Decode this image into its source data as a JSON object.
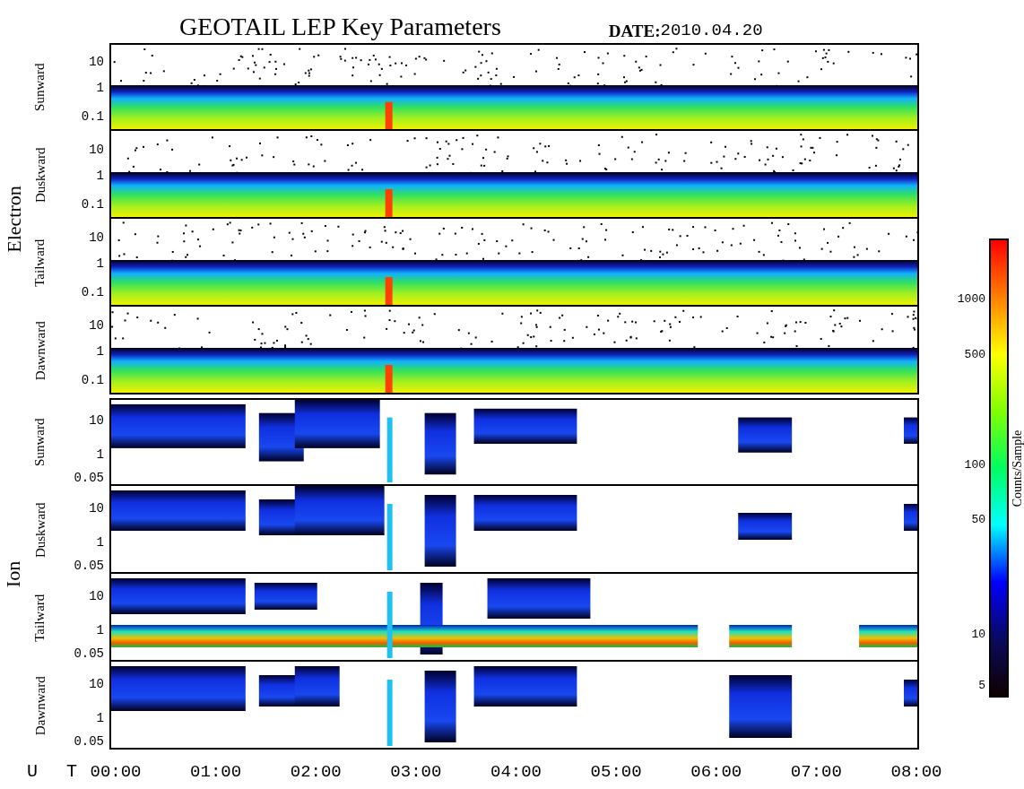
{
  "title": "GEOTAIL LEP Key Parameters",
  "date": {
    "label": "DATE:",
    "value": "2010.04.20"
  },
  "groups": [
    {
      "label": "Electron",
      "kind": "electron",
      "panels": [
        {
          "label": "Sunward",
          "yticks": [
            "10",
            "1",
            "0.1"
          ]
        },
        {
          "label": "Duskward",
          "yticks": [
            "10",
            "1",
            "0.1"
          ]
        },
        {
          "label": "Tailward",
          "yticks": [
            "10",
            "1",
            "0.1"
          ]
        },
        {
          "label": "Dawnward",
          "yticks": [
            "10",
            "1",
            "0.1"
          ]
        }
      ]
    },
    {
      "label": "Ion",
      "kind": "ion",
      "panels": [
        {
          "label": "Sunward",
          "yticks": [
            "10",
            "1",
            "0.05"
          ]
        },
        {
          "label": "Duskward",
          "yticks": [
            "10",
            "1",
            "0.05"
          ]
        },
        {
          "label": "Tailward",
          "yticks": [
            "10",
            "1",
            "0.05"
          ]
        },
        {
          "label": "Dawnward",
          "yticks": [
            "10",
            "1",
            "0.05"
          ]
        }
      ]
    }
  ],
  "x_axis": {
    "label": "U T",
    "ticks": [
      "00:00",
      "01:00",
      "02:00",
      "03:00",
      "04:00",
      "05:00",
      "06:00",
      "07:00",
      "08:00"
    ]
  },
  "colorbar": {
    "label": "Counts/Sample",
    "ticks": [
      "1000",
      "500",
      "100",
      "50",
      "10",
      "5"
    ]
  }
}
